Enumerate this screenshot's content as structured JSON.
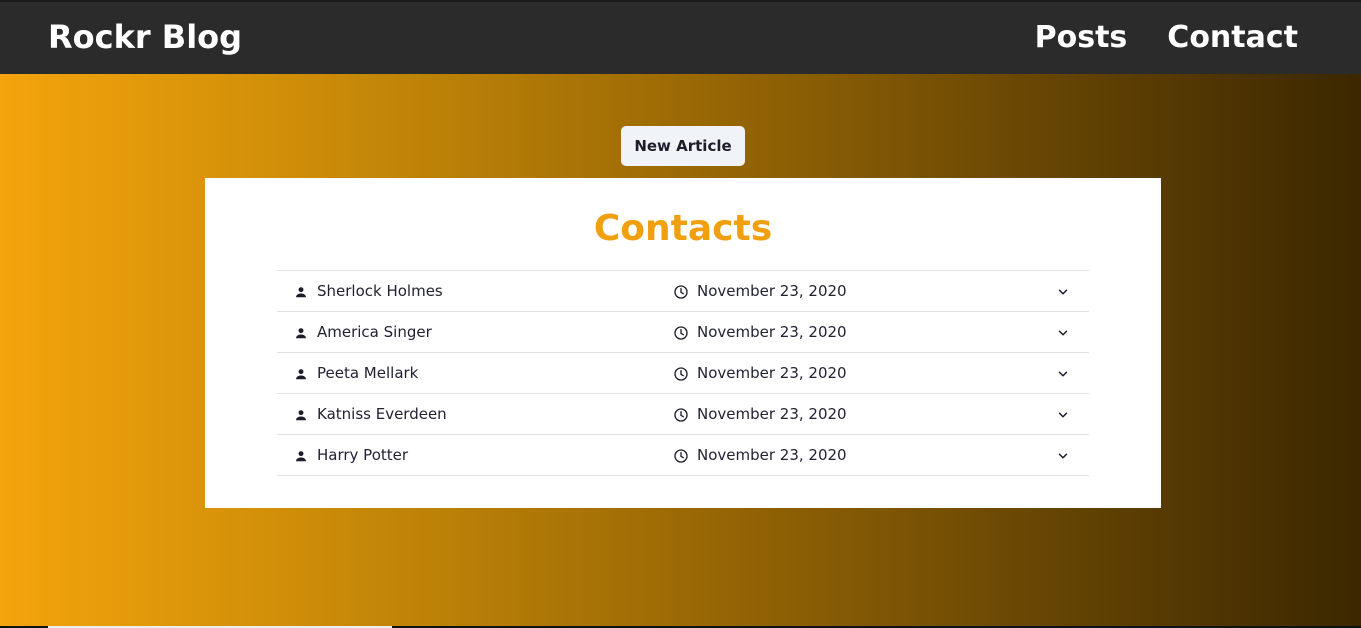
{
  "header": {
    "brand": "Rockr Blog",
    "nav": [
      {
        "label": "Posts"
      },
      {
        "label": "Contact"
      }
    ]
  },
  "actions": {
    "new_article_label": "New Article"
  },
  "contacts": {
    "title": "Contacts",
    "items": [
      {
        "name": "Sherlock Holmes",
        "date": "November 23, 2020"
      },
      {
        "name": "America Singer",
        "date": "November 23, 2020"
      },
      {
        "name": "Peeta Mellark",
        "date": "November 23, 2020"
      },
      {
        "name": "Katniss Everdeen",
        "date": "November 23, 2020"
      },
      {
        "name": "Harry Potter",
        "date": "November 23, 2020"
      }
    ]
  },
  "icons": {
    "person": "person-icon",
    "clock": "clock-icon",
    "chevron": "chevron-down-icon"
  },
  "colors": {
    "navbar": "#2b2b2b",
    "accent": "#f0a00e",
    "gradient_start": "#f4a40c",
    "gradient_end": "#3b2700"
  }
}
